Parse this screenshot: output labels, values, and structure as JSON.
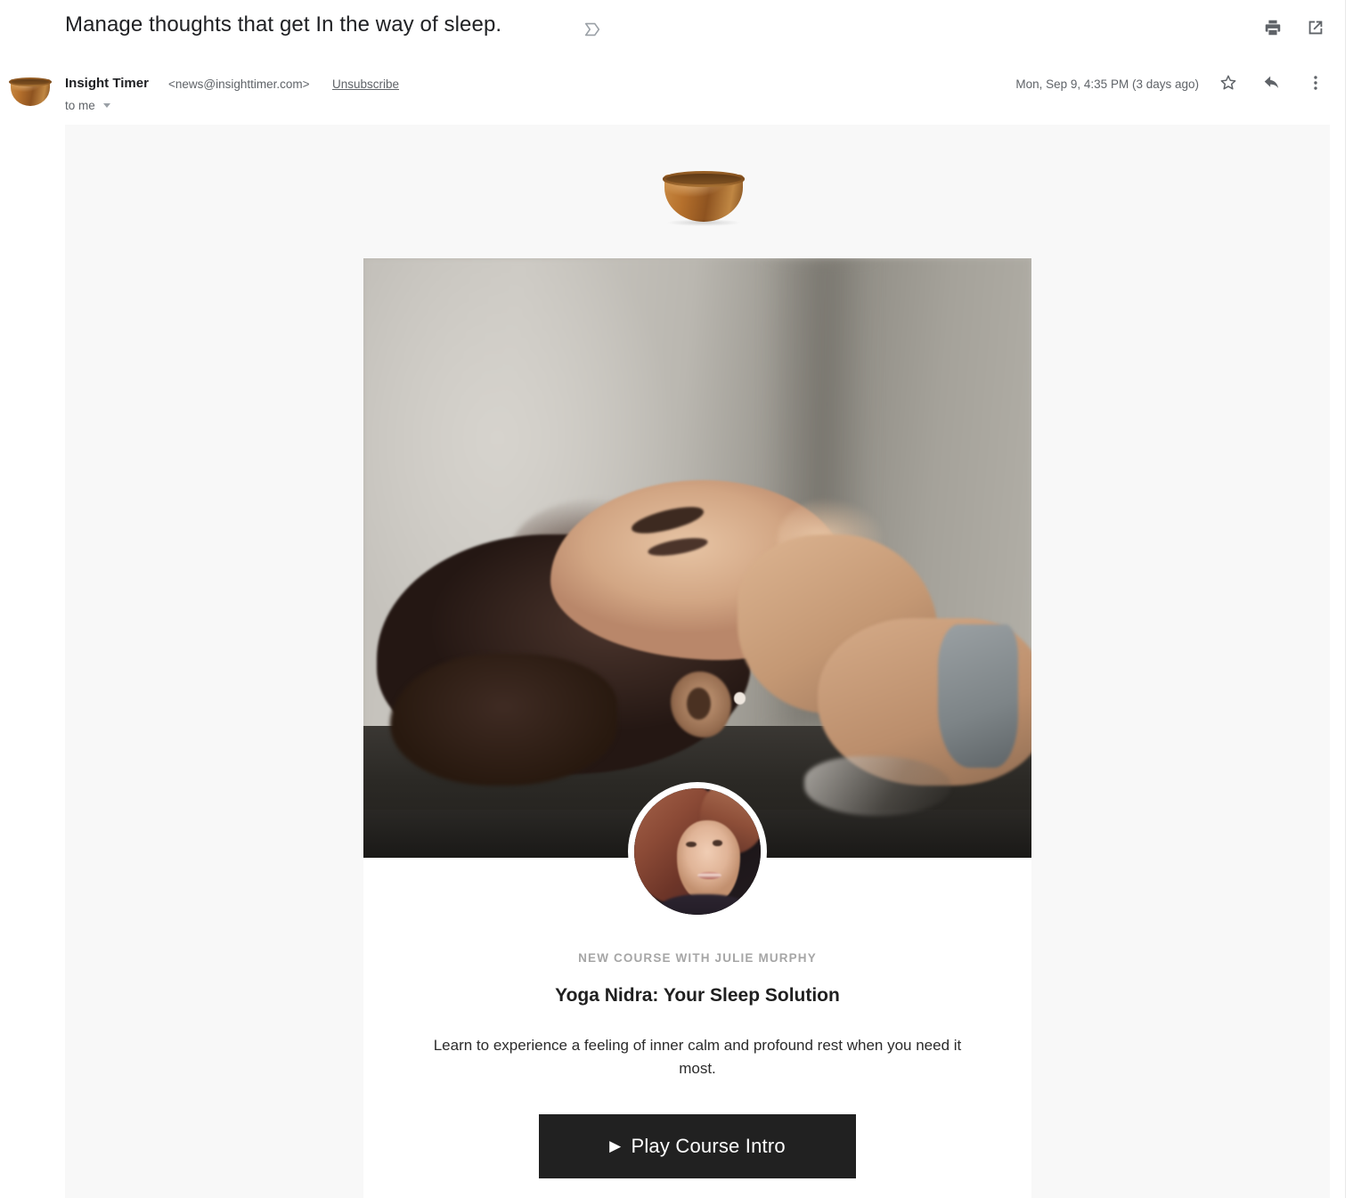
{
  "email_header": {
    "subject": "Manage thoughts that get In the way of sleep.",
    "inbox_tag_icon": "inbox-label-icon",
    "actions": [
      {
        "name": "print-icon",
        "label": "Print"
      },
      {
        "name": "open-in-new-window-icon",
        "label": "Open in new window"
      }
    ]
  },
  "sender": {
    "avatar_icon": "singing-bowl-avatar",
    "name": "Insight Timer",
    "email": "<news@insighttimer.com>",
    "unsubscribe_label": "Unsubscribe",
    "recipient": "to me",
    "timestamp": "Mon, Sep 9, 4:35 PM (3 days ago)",
    "actions": [
      {
        "name": "star-icon",
        "label": "Star"
      },
      {
        "name": "reply-icon",
        "label": "Reply"
      },
      {
        "name": "more-options-icon",
        "label": "More"
      }
    ]
  },
  "email_body": {
    "background_color": "#f8f8f8",
    "card_background_color": "#ffffff",
    "brand_logo_icon": "singing-bowl-logo",
    "hero_image_alt": "Woman lying on a yoga mat with eyes closed",
    "instructor_avatar_alt": "Julie Murphy portrait",
    "eyebrow": "NEW COURSE WITH JULIE MURPHY",
    "title": "Yoga Nidra: Your Sleep Solution",
    "description": "Learn to experience a feeling of inner calm and profound rest when you need it most.",
    "cta": {
      "label": "Play Course Intro",
      "play_glyph": "▶",
      "background_color": "#212121",
      "text_color": "#ffffff"
    }
  }
}
